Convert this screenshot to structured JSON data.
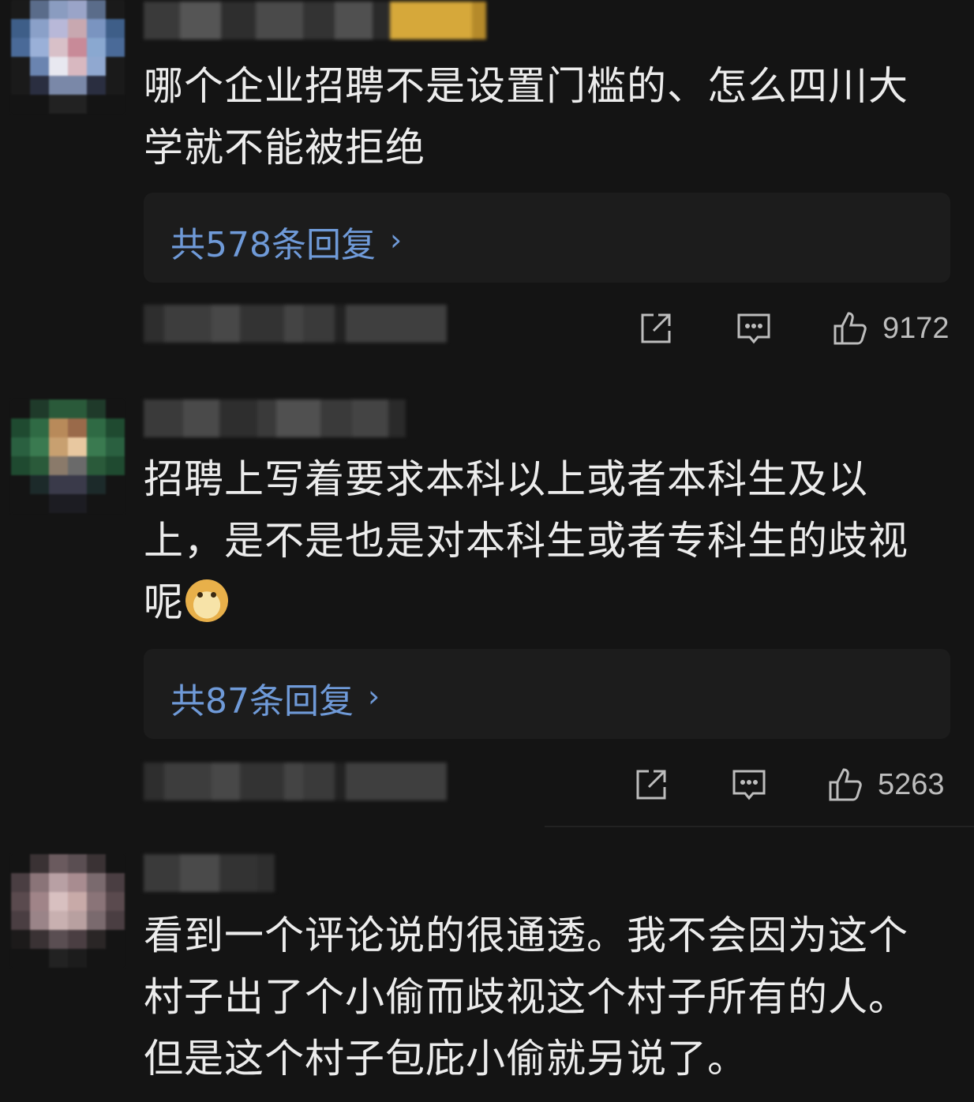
{
  "comments": [
    {
      "text": "哪个企业招聘不是设置门槛的、怎么四川大学就不能被拒绝",
      "replies_label": "共578条回复",
      "likes": "9172"
    },
    {
      "text": "招聘上写着要求本科以上或者本科生及以上，是不是也是对本科生或者专科生的歧视呢",
      "replies_label": "共87条回复",
      "likes": "5263"
    },
    {
      "text": "看到一个评论说的很通透。我不会因为这个村子出了个小偷而歧视这个村子所有的人。但是这个村子包庇小偷就另说了。"
    }
  ],
  "icons": {
    "share": "share-icon",
    "comment": "comment-icon",
    "like": "thumbs-up-icon",
    "reply_arrow": "chevron-right-icon",
    "emoji": "doge-emoji"
  },
  "colors": {
    "background": "#141414",
    "text": "#ececec",
    "link": "#6f9ad8",
    "reply_box": "#1c1c1c",
    "count": "#bdbdbd"
  }
}
